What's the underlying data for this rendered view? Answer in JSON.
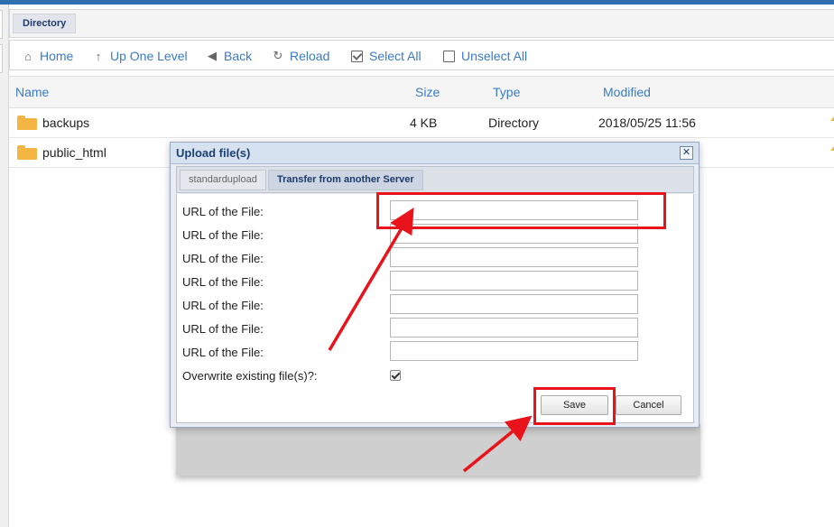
{
  "directory_tab": "Directory",
  "toolbar": {
    "home": "Home",
    "up_one_level": "Up One Level",
    "back": "Back",
    "reload": "Reload",
    "select_all": "Select All",
    "unselect_all": "Unselect All"
  },
  "columns": {
    "name": "Name",
    "size": "Size",
    "type": "Type",
    "modified": "Modified"
  },
  "files": [
    {
      "name": "backups",
      "size": "4 KB",
      "type": "Directory",
      "modified": "2018/05/25 11:56"
    },
    {
      "name": "public_html",
      "size": "",
      "type": "",
      "modified": ""
    }
  ],
  "dialog": {
    "title": "Upload file(s)",
    "close_symbol": "✕",
    "tabs": [
      "standardupload",
      "Transfer from another Server"
    ],
    "active_tab": "Transfer from another Server",
    "url_label": "URL of the File:",
    "url_fields": [
      "",
      "",
      "",
      "",
      "",
      "",
      ""
    ],
    "overwrite_label": "Overwrite existing file(s)?:",
    "overwrite_checked": true,
    "save_label": "Save",
    "cancel_label": "Cancel"
  },
  "colors": {
    "accent": "#3a7bc2",
    "annotation": "#e8131b",
    "folder": "#f4b543"
  }
}
